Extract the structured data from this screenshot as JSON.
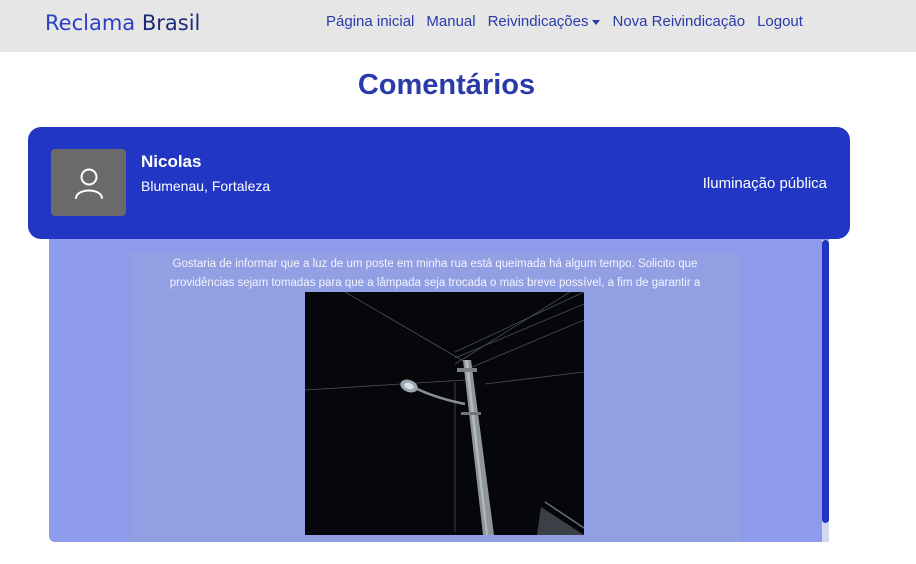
{
  "navbar": {
    "brand_part1": "Reclama",
    "brand_part2": "Brasil",
    "links": {
      "home": "Página inicial",
      "manual": "Manual",
      "claims": "Reivindicações",
      "new_claim": "Nova Reivindicação",
      "logout": "Logout"
    }
  },
  "page": {
    "title": "Comentários"
  },
  "claim": {
    "user_name": "Nicolas",
    "location": "Blumenau, Fortaleza",
    "category": "Iluminação pública",
    "description": "Gostaria de informar que a luz de um poste em minha rua está queimada há algum tempo. Solicito que providências sejam tomadas para que a lâmpada seja trocada o mais breve possível, a fim de garantir a",
    "image_icon": "street-lamp-photo"
  },
  "colors": {
    "brand_primary": "#2236c4",
    "navbar_bg": "#e6e6e6",
    "panel_bg": "#8d9bea",
    "avatar_bg": "#6a6a6a"
  }
}
